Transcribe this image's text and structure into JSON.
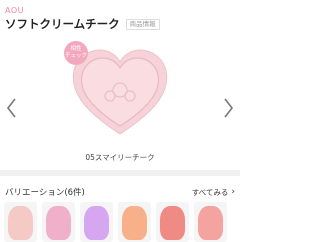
{
  "header": {
    "brand": "AOU",
    "title": "ソフトクリームチーク",
    "tag": "商品情報"
  },
  "badge": {
    "line1": "相性",
    "line2": "チェック"
  },
  "product": {
    "name": "05スマイリーチーク"
  },
  "colors": {
    "heart_body": "#f6d3d8",
    "heart_edge": "#f0c2c9",
    "accent": "#f08aa6"
  },
  "variations": {
    "title": "バリエーション(6件)",
    "see_all": "すべてみる",
    "swatches": [
      {
        "name": "swatch-1",
        "color": "#f4c9c6"
      },
      {
        "name": "swatch-2",
        "color": "#f0b0c9"
      },
      {
        "name": "swatch-3",
        "color": "#d6a6f0"
      },
      {
        "name": "swatch-4",
        "color": "#f7b08a"
      },
      {
        "name": "swatch-5",
        "color": "#f08a84"
      },
      {
        "name": "swatch-6",
        "color": "#f5a3a1"
      }
    ]
  }
}
